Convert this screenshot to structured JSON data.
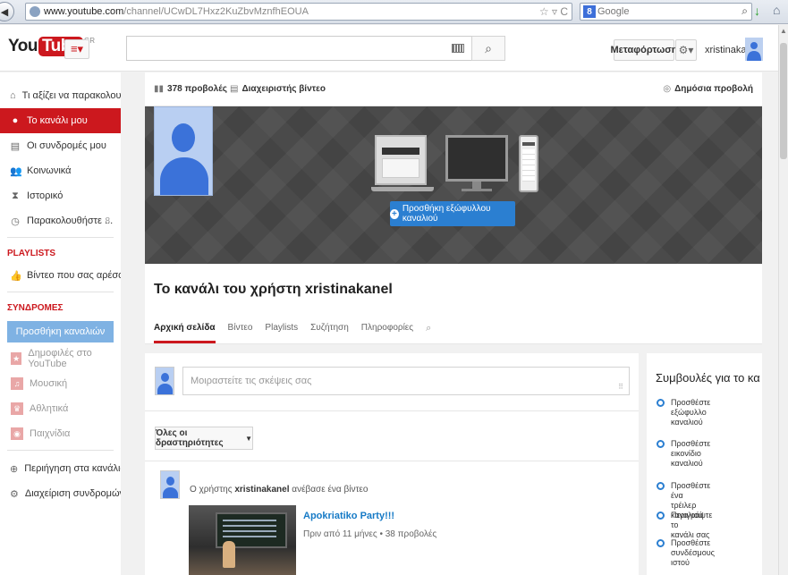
{
  "browser": {
    "url_host": "www.youtube.com",
    "url_path": "/channel/UCwDL7Hxz2KuZbvMznfhEOUA",
    "search_engine_label": "Google"
  },
  "header": {
    "logo_you": "You",
    "logo_tube": "Tube",
    "logo_region": "GR",
    "upload_label": "Μεταφόρτωση",
    "username": "xristinakanel"
  },
  "sidebar": {
    "items": [
      {
        "label": "Τι αξίζει να παρακολουθ...",
        "icon": "home-icon",
        "count": ""
      },
      {
        "label": "Το κανάλι μου",
        "icon": "user-icon",
        "count": ""
      },
      {
        "label": "Οι συνδρομές μου",
        "icon": "subscriptions-icon",
        "count": ""
      },
      {
        "label": "Κοινωνικά",
        "icon": "social-icon",
        "count": ""
      },
      {
        "label": "Ιστορικό",
        "icon": "history-icon",
        "count": ""
      },
      {
        "label": "Παρακολουθήστε ...",
        "icon": "clock-icon",
        "count": "8"
      }
    ],
    "playlists_heading": "PLAYLISTS",
    "liked_videos": "Βίντεο που σας αρέσουν",
    "subscriptions_heading": "ΣΥΝΔΡΟΜΕΣ",
    "add_channels_label": "Προσθήκη καναλιών",
    "subscriptions": [
      {
        "label": "Δημοφιλές στο YouTube",
        "icon": "star-icon"
      },
      {
        "label": "Μουσική",
        "icon": "headphones-icon"
      },
      {
        "label": "Αθλητικά",
        "icon": "trophy-icon"
      },
      {
        "label": "Παιχνίδια",
        "icon": "gamepad-icon"
      }
    ],
    "browse_channels": "Περιήγηση στα κανάλια",
    "manage_subscriptions": "Διαχείριση συνδρομών"
  },
  "channel": {
    "views_label": "378 προβολές",
    "video_manager_label": "Διαχειριστής βίντεο",
    "public_view_label": "Δημόσια προβολή",
    "add_art_label": "Προσθήκη εξώφυλλου καναλιού",
    "title": "Το κανάλι του χρήστη xristinakanel",
    "tabs": [
      "Αρχική σελίδα",
      "Βίντεο",
      "Playlists",
      "Συζήτηση",
      "Πληροφορίες"
    ]
  },
  "feed": {
    "share_placeholder": "Μοιραστείτε τις σκέψεις σας",
    "filter_label": "Όλες οι δραστηριότητες",
    "activity_prefix": "Ο χρήστης",
    "activity_user": "xristinakanel",
    "activity_suffix": "ανέβασε ένα βίντεο",
    "video_title": "Apokriatiko Party!!!",
    "video_meta": "Πριν από 11 μήνες • 38 προβολές"
  },
  "tips": {
    "title": "Συμβουλές για το κα...",
    "items": [
      [
        "Προσθέστε",
        "εξώφυλλο",
        "καναλιού"
      ],
      [
        "Προσθέστε",
        "εικονίδιο",
        "καναλιού"
      ],
      [
        "Προσθέστε ένα",
        "τρέιλερ καναλιού"
      ],
      [
        "Περιγράψτε το",
        "κανάλι σας"
      ],
      [
        "Προσθέστε",
        "συνδέσμους",
        "ιστού"
      ]
    ]
  }
}
